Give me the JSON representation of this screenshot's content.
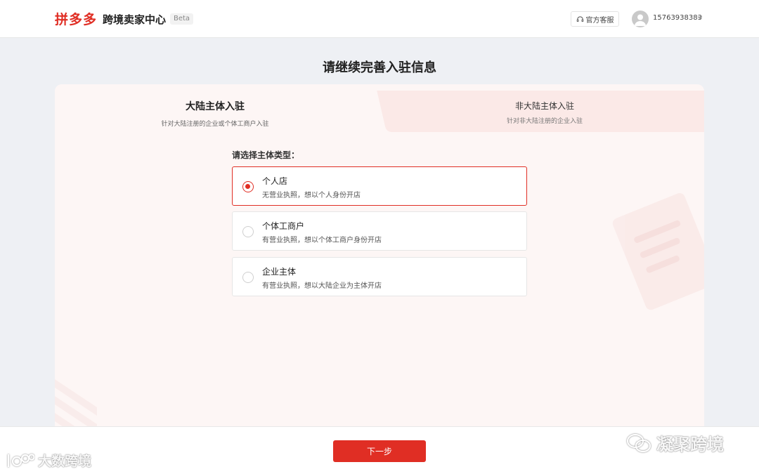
{
  "header": {
    "logo": "拼多多",
    "app_title": "跨境卖家中心",
    "beta": "Beta",
    "customer_service": "官方客服",
    "user_phone": "15763938383"
  },
  "page_title": "请继续完善入驻信息",
  "tabs": [
    {
      "label": "大陆主体入驻",
      "sub": "针对大陆注册的企业或个体工商户入驻",
      "active": true
    },
    {
      "label": "非大陆主体入驻",
      "sub": "针对非大陆注册的企业入驻",
      "active": false
    }
  ],
  "select_label": "请选择主体类型：",
  "options": [
    {
      "title": "个人店",
      "desc": "无营业执照，想以个人身份开店",
      "selected": true
    },
    {
      "title": "个体工商户",
      "desc": "有营业执照，想以个体工商户身份开店",
      "selected": false
    },
    {
      "title": "企业主体",
      "desc": "有营业执照，想以大陆企业为主体开店",
      "selected": false
    }
  ],
  "footer": {
    "next_label": "下一步"
  },
  "watermarks": {
    "left": "大数跨境",
    "right": "凝聚跨境"
  },
  "colors": {
    "brand": "#e02e24",
    "card_bg": "#fdf6f5",
    "page_bg": "#eef0f4"
  }
}
